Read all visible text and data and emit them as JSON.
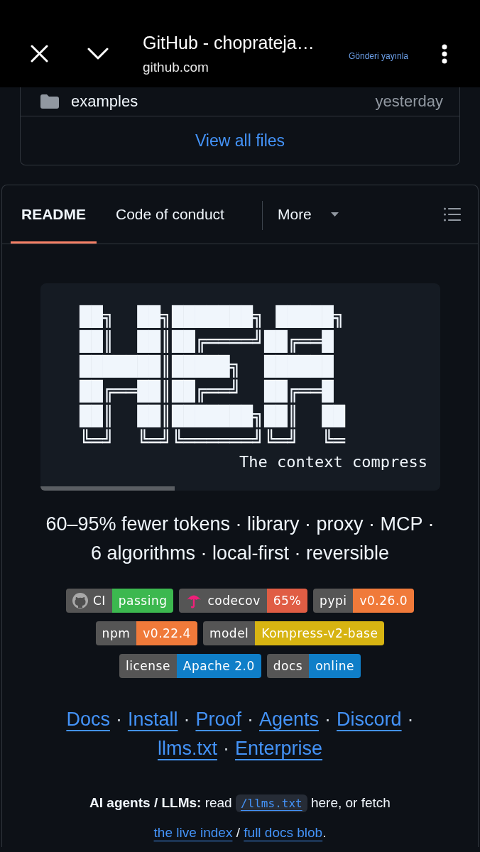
{
  "browser_bar": {
    "title": "GitHub - choprateja…",
    "url": "github.com",
    "action": "Gönderi yayınla"
  },
  "file_list": {
    "rows": [
      {
        "kind": "folder",
        "name": "examples",
        "updated": "yesterday"
      }
    ],
    "view_all": "View all files"
  },
  "readme": {
    "tabs": [
      {
        "label": "README",
        "selected": true
      },
      {
        "label": "Code of conduct",
        "selected": false
      }
    ],
    "more": "More",
    "banner": {
      "ascii_art": [
        "██╗  ██╗███████╗ █████╗",
        "██║  ██║██╔════╝██╔══█",
        "███████║█████╗  ██████",
        "██╔══██║██╔══╝  ██╔══█",
        "██║  ██║███████╗██║  ██",
        "╚═╝  ╚═╝╚══════╝╚═╝  ╚═"
      ],
      "tagline": "The context compress"
    },
    "description": "60–95% fewer tokens · library · proxy · MCP · 6 algorithms · local-first · reversible",
    "badge_rows": [
      {
        "badges": [
          {
            "kind": "ci",
            "label": "CI",
            "value": "passing",
            "color": "#3cb84f"
          },
          {
            "kind": "coverage",
            "label": "codecov",
            "value": "65%",
            "color": "#e05d44"
          },
          {
            "kind": "plain",
            "label": "pypi",
            "value": "v0.26.0",
            "color": "#f07a3a"
          }
        ]
      },
      {
        "badges": [
          {
            "kind": "plain",
            "label": "npm",
            "value": "v0.22.4",
            "color": "#f07a3a"
          },
          {
            "kind": "plain",
            "label": "model",
            "value": "Kompress-v2-base",
            "color": "#d7b412"
          }
        ]
      },
      {
        "badges": [
          {
            "kind": "plain",
            "label": "license",
            "value": "Apache 2.0",
            "color": "#0f7ec8"
          },
          {
            "kind": "plain",
            "label": "docs",
            "value": "online",
            "color": "#0f7ec8"
          }
        ]
      }
    ],
    "links": [
      {
        "label": "Docs",
        "separator": "·"
      },
      {
        "label": "Install",
        "separator": "·"
      },
      {
        "label": "Proof",
        "separator": "·"
      },
      {
        "label": "Agents",
        "separator": "·"
      },
      {
        "label": "Discord",
        "separator": "·"
      },
      {
        "label": "llms.txt",
        "separator": "·"
      },
      {
        "label": "Enterprise"
      }
    ],
    "agent_note": {
      "parts": [
        {
          "kind": "text",
          "text": "**AI agents / LLMs:** read "
        },
        {
          "kind": "code_link",
          "text": "/llms.txt"
        },
        {
          "kind": "text",
          "text": " here, or fetch "
        },
        {
          "kind": "link",
          "text": "the live index"
        },
        {
          "kind": "text",
          "text": " / "
        },
        {
          "kind": "link",
          "text": "full docs blob"
        },
        {
          "kind": "text",
          "text": "."
        }
      ]
    }
  }
}
